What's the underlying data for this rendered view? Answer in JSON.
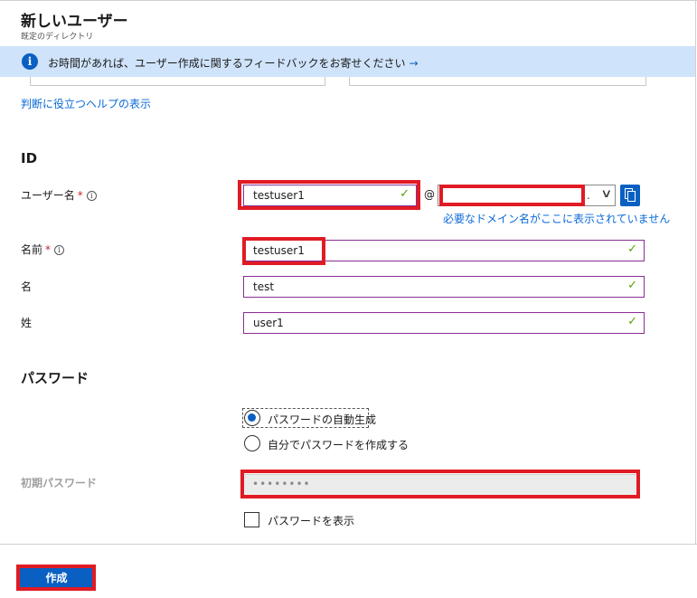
{
  "header": {
    "title": "新しいユーザー",
    "subtitle": "既定のディレクトリ"
  },
  "banner": {
    "text": "お時間があれば、ユーザー作成に関するフィードバックをお寄せください",
    "arrow": "→",
    "icon": "info-icon"
  },
  "help_link": "判断に役立つヘルプの表示",
  "identity": {
    "section_title": "ID",
    "username": {
      "label": "ユーザー名",
      "required_mark": "*",
      "info": "i",
      "value": "testuser1",
      "at": "@",
      "domain_value": "",
      "domain_dot": ".",
      "domain_warning": "必要なドメイン名がここに表示されていません"
    },
    "name": {
      "label": "名前",
      "required_mark": "*",
      "info": "i",
      "value": "testuser1"
    },
    "first_name": {
      "label": "名",
      "value": "test"
    },
    "last_name": {
      "label": "姓",
      "value": "user1"
    }
  },
  "password": {
    "section_title": "パスワード",
    "options": [
      {
        "label": "パスワードの自動生成",
        "selected": true
      },
      {
        "label": "自分でパスワードを作成する",
        "selected": false
      }
    ],
    "initial_label": "初期パスワード",
    "initial_value": "••••••••",
    "show_password_label": "パスワードを表示",
    "show_password_checked": false
  },
  "footer": {
    "create_label": "作成"
  },
  "colors": {
    "accent": "#0a60c2",
    "banner_bg": "#cfe3fa",
    "valid_check": "#57a300",
    "highlight_red": "#e01b24",
    "field_border": "#8b2d94"
  }
}
